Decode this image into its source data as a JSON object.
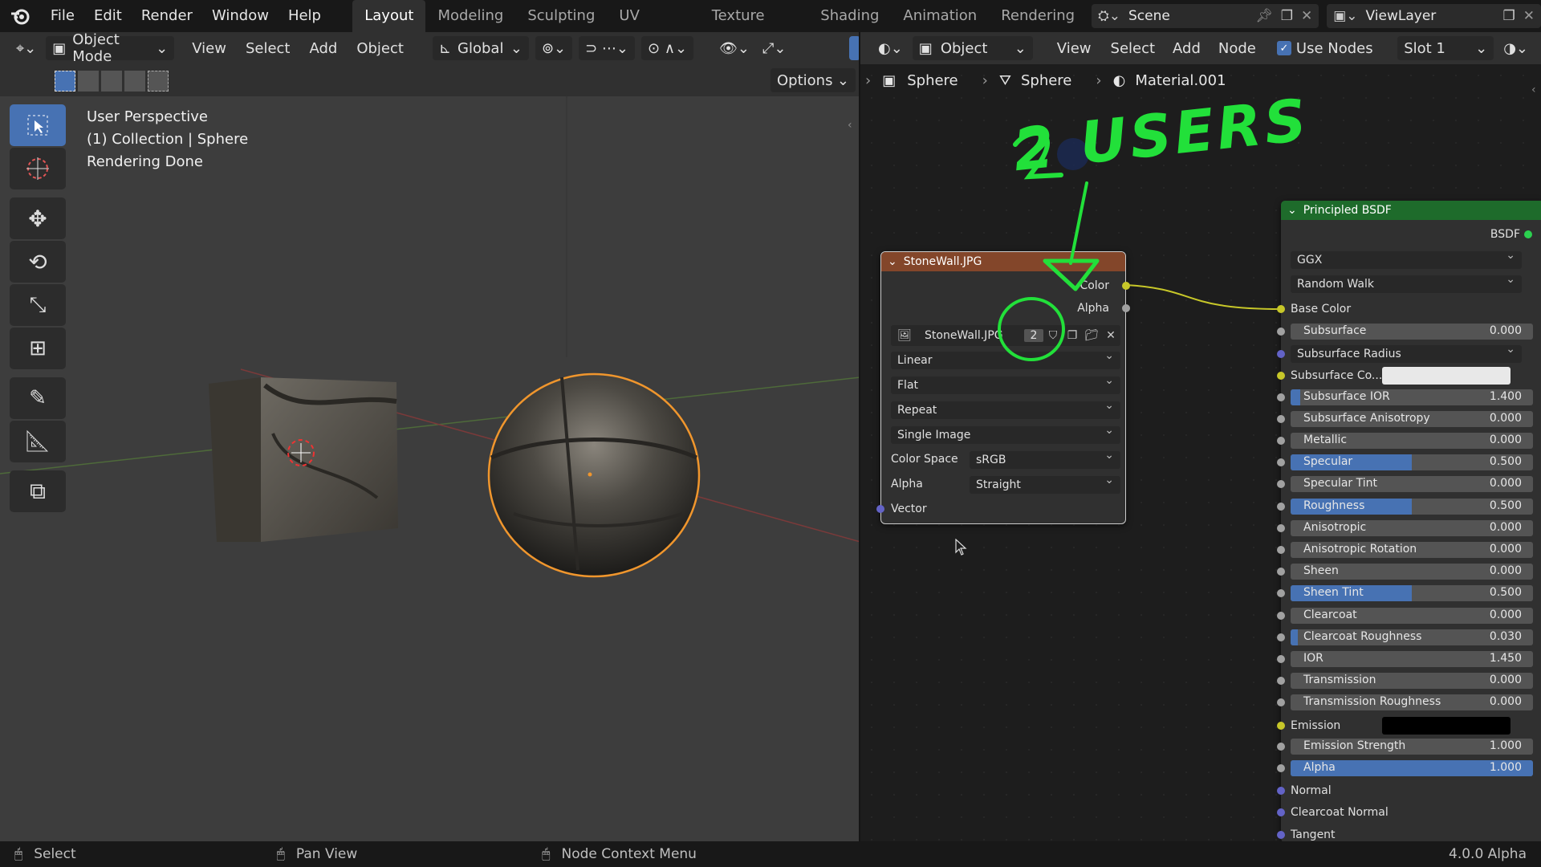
{
  "topbar": {
    "menus": [
      "File",
      "Edit",
      "Render",
      "Window",
      "Help"
    ],
    "workspaces": [
      "Layout",
      "Modeling",
      "Sculpting",
      "UV Editing",
      "Texture Paint",
      "Shading",
      "Animation",
      "Rendering"
    ],
    "active_workspace": "Layout",
    "scene": "Scene",
    "view_layer": "ViewLayer"
  },
  "viewport": {
    "mode": "Object Mode",
    "menus": [
      "View",
      "Select",
      "Add",
      "Object"
    ],
    "orientation": "Global",
    "options_label": "Options",
    "overlay_text": [
      "User Perspective",
      "(1) Collection | Sphere",
      "Rendering Done"
    ]
  },
  "node_editor": {
    "object_dropdown": "Object",
    "menus": [
      "View",
      "Select",
      "Add",
      "Node"
    ],
    "use_nodes_label": "Use Nodes",
    "use_nodes_checked": true,
    "slot": "Slot 1",
    "breadcrumb": [
      "Sphere",
      "Sphere",
      "Material.001"
    ],
    "annotation": "2 USERS"
  },
  "image_node": {
    "title": "StoneWall.JPG",
    "outputs": [
      "Color",
      "Alpha"
    ],
    "image_name": "StoneWall.JPG",
    "user_count": "2",
    "interpolation": "Linear",
    "projection": "Flat",
    "extension": "Repeat",
    "source": "Single Image",
    "color_space_label": "Color Space",
    "color_space": "sRGB",
    "alpha_label": "Alpha",
    "alpha_mode": "Straight",
    "input": "Vector",
    "header_color": "#83462a"
  },
  "bsdf_node": {
    "title": "Principled BSDF",
    "output": "BSDF",
    "distribution": "GGX",
    "subsurface_method": "Random Walk",
    "base_color_label": "Base Color",
    "subsurface_radius": "Subsurface Radius",
    "subsurface_color_label": "Subsurface Co...",
    "emission_label": "Emission",
    "header_color": "#1e6b2b",
    "sliders": [
      {
        "label": "Subsurface",
        "value": "0.000",
        "fill": 0
      },
      {
        "label": "Subsurface IOR",
        "value": "1.400",
        "fill": 0.04
      },
      {
        "label": "Subsurface Anisotropy",
        "value": "0.000",
        "fill": 0
      },
      {
        "label": "Metallic",
        "value": "0.000",
        "fill": 0
      },
      {
        "label": "Specular",
        "value": "0.500",
        "fill": 0.5
      },
      {
        "label": "Specular Tint",
        "value": "0.000",
        "fill": 0
      },
      {
        "label": "Roughness",
        "value": "0.500",
        "fill": 0.5
      },
      {
        "label": "Anisotropic",
        "value": "0.000",
        "fill": 0
      },
      {
        "label": "Anisotropic Rotation",
        "value": "0.000",
        "fill": 0
      },
      {
        "label": "Sheen",
        "value": "0.000",
        "fill": 0
      },
      {
        "label": "Sheen Tint",
        "value": "0.500",
        "fill": 0.5
      },
      {
        "label": "Clearcoat",
        "value": "0.000",
        "fill": 0
      },
      {
        "label": "Clearcoat Roughness",
        "value": "0.030",
        "fill": 0.03
      },
      {
        "label": "IOR",
        "value": "1.450",
        "fill": 0
      },
      {
        "label": "Transmission",
        "value": "0.000",
        "fill": 0
      },
      {
        "label": "Transmission Roughness",
        "value": "0.000",
        "fill": 0
      }
    ],
    "emission_strength": {
      "label": "Emission Strength",
      "value": "1.000",
      "fill": 0
    },
    "alpha": {
      "label": "Alpha",
      "value": "1.000",
      "fill": 1
    },
    "inputs_bottom": [
      "Normal",
      "Clearcoat Normal",
      "Tangent"
    ]
  },
  "statusbar": {
    "select": "Select",
    "pan": "Pan View",
    "context": "Node Context Menu",
    "version": "4.0.0 Alpha"
  }
}
